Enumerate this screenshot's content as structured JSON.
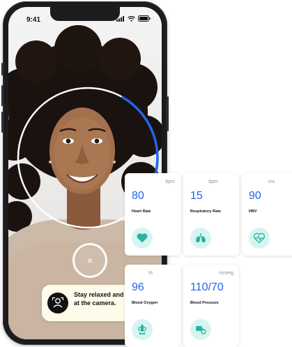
{
  "status_bar": {
    "time": "9:41"
  },
  "hint": {
    "text": "Stay relaxed and still. Look at the camera."
  },
  "cancel": {
    "glyph": "×"
  },
  "colors": {
    "accent": "#2563eb",
    "icon_bg": "#d6f5f1",
    "icon_fg": "#2bb3a3",
    "hint_bg": "#fffbea"
  },
  "scan_progress": 0.2,
  "metrics": [
    {
      "unit": "bpm",
      "value": "80",
      "label": "Heart Rate",
      "icon": "heart-icon"
    },
    {
      "unit": "bpm",
      "value": "15",
      "label": "Respiratory Rate",
      "icon": "lungs-icon"
    },
    {
      "unit": "ms",
      "value": "90",
      "label": "HRV",
      "icon": "heart-pulse-icon"
    },
    {
      "unit": "%",
      "value": "96",
      "label": "Blood Oxygen",
      "icon": "finger-oximeter-icon"
    },
    {
      "unit": "mmHg",
      "value": "110/70",
      "label": "Blood Pressure",
      "icon": "blood-pressure-cuff-icon"
    }
  ]
}
